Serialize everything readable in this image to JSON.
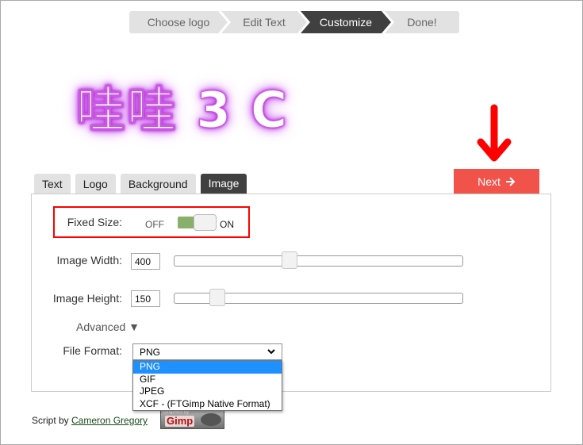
{
  "stepper": {
    "steps": [
      {
        "label": "Choose logo",
        "active": false
      },
      {
        "label": "Edit Text",
        "active": false
      },
      {
        "label": "Customize",
        "active": true
      },
      {
        "label": "Done!",
        "active": false
      }
    ]
  },
  "preview": {
    "logo_text": "哇哇 3 C",
    "glow_color": "#c030e0"
  },
  "next_button": {
    "label": "Next",
    "icon": "arrow-right-icon",
    "color": "#f1524a"
  },
  "annotation": {
    "arrow_icon": "arrow-down-icon",
    "color": "#ff0000"
  },
  "tabs": [
    {
      "label": "Text",
      "active": false
    },
    {
      "label": "Logo",
      "active": false
    },
    {
      "label": "Background",
      "active": false
    },
    {
      "label": "Image",
      "active": true
    }
  ],
  "image_panel": {
    "fixed_size": {
      "label": "Fixed Size:",
      "off_label": "OFF",
      "on_label": "ON",
      "state": "on"
    },
    "image_width": {
      "label": "Image Width:",
      "value": "400",
      "slider_fraction": 0.4
    },
    "image_height": {
      "label": "Image Height:",
      "value": "150",
      "slider_fraction": 0.15
    },
    "advanced": {
      "label": "Advanced ▼"
    },
    "file_format": {
      "label": "File Format:",
      "selected": "PNG",
      "options": [
        "PNG",
        "GIF",
        "JPEG",
        "XCF - (FTGimp Native Format)"
      ],
      "highlighted_index": 0
    }
  },
  "footer": {
    "prefix": "Script by ",
    "author_link": "Cameron Gregory",
    "badge_small": "Graphics by",
    "badge_text": "Gimp"
  }
}
